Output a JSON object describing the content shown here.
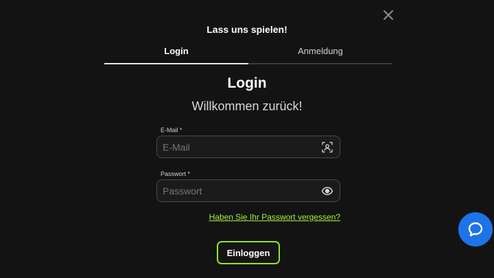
{
  "modal": {
    "title": "Lass uns spielen!",
    "close_icon": "close-icon"
  },
  "tabs": [
    {
      "label": "Login",
      "active": true
    },
    {
      "label": "Anmeldung",
      "active": false
    }
  ],
  "form": {
    "heading": "Login",
    "subheading": "Willkommen zurück!",
    "email": {
      "label": "E-Mail *",
      "placeholder": "E-Mail",
      "value": "",
      "icon": "contact-icon"
    },
    "password": {
      "label": "Passwort *",
      "placeholder": "Passwort",
      "value": "",
      "icon": "eye-icon"
    },
    "forgot_link": "Haben Sie Ihr Passwort vergessen?",
    "submit_label": "Einloggen"
  },
  "chat_widget": {
    "icon": "chat-icon",
    "color": "#1e73e8"
  },
  "colors": {
    "accent": "#8ee82a",
    "background": "#131313"
  }
}
